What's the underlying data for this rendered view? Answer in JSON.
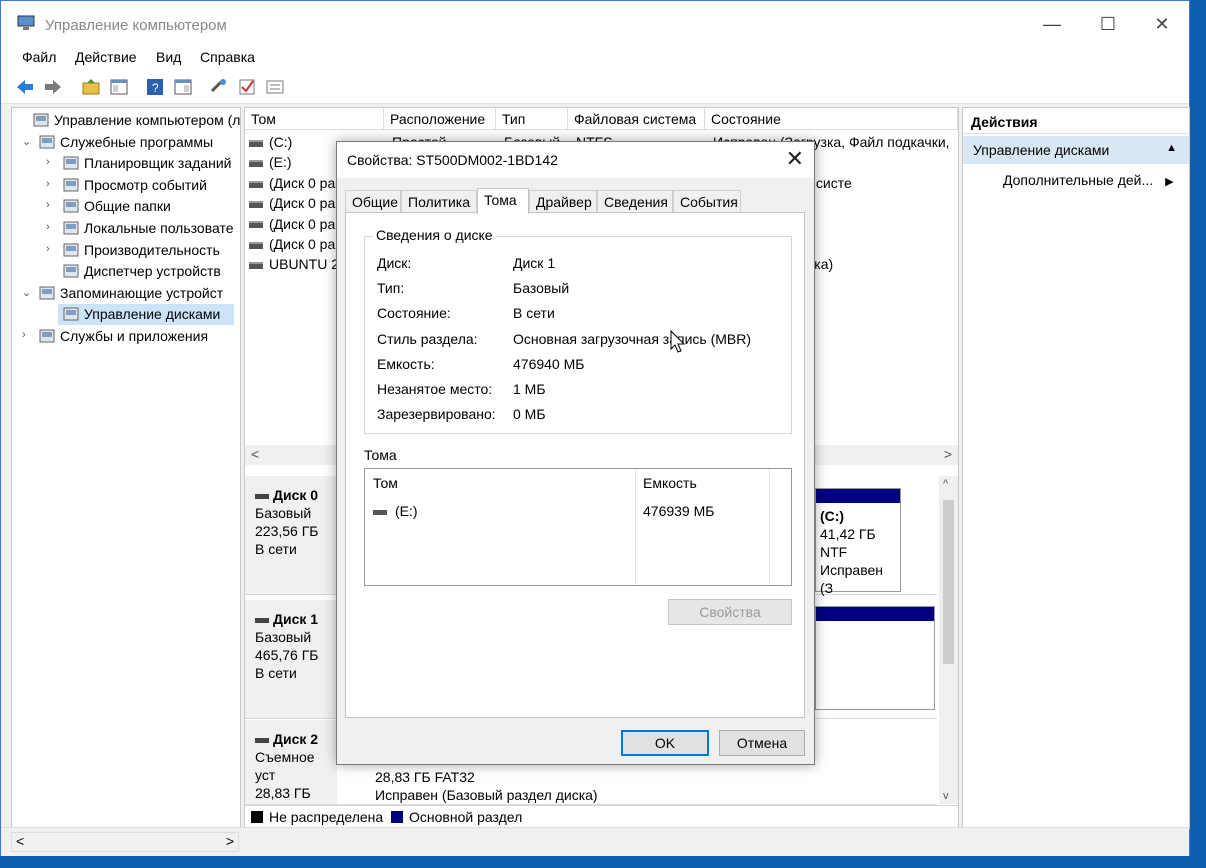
{
  "window": {
    "title": "Управление компьютером",
    "controls": [
      "—",
      "☐",
      "✕"
    ]
  },
  "menu": [
    "Файл",
    "Действие",
    "Вид",
    "Справка"
  ],
  "tree": [
    {
      "label": "Управление компьютером (л",
      "level": 0,
      "arrow": "",
      "icon": "computer-management-icon"
    },
    {
      "label": "Служебные программы",
      "level": 1,
      "arrow": "v",
      "icon": "tools-icon"
    },
    {
      "label": "Планировщик заданий",
      "level": 2,
      "arrow": ">",
      "icon": "clock-icon"
    },
    {
      "label": "Просмотр событий",
      "level": 2,
      "arrow": ">",
      "icon": "event-viewer-icon"
    },
    {
      "label": "Общие папки",
      "level": 2,
      "arrow": ">",
      "icon": "shared-folder-icon"
    },
    {
      "label": "Локальные пользовате",
      "level": 2,
      "arrow": ">",
      "icon": "users-icon"
    },
    {
      "label": "Производительность",
      "level": 2,
      "arrow": ">",
      "icon": "performance-icon"
    },
    {
      "label": "Диспетчер устройств",
      "level": 2,
      "arrow": "",
      "icon": "device-manager-icon"
    },
    {
      "label": "Запоминающие устройст",
      "level": 1,
      "arrow": "v",
      "icon": "storage-icon"
    },
    {
      "label": "Управление дисками",
      "level": 2,
      "arrow": "",
      "icon": "disk-management-icon",
      "selected": true
    },
    {
      "label": "Службы и приложения",
      "level": 1,
      "arrow": ">",
      "icon": "services-icon"
    }
  ],
  "volumes": {
    "headers": [
      "Том",
      "Расположение",
      "Тип",
      "Файловая система",
      "Состояние"
    ],
    "rows": [
      {
        "name": "(C:)",
        "layout": "Простой",
        "type": "Базовый",
        "fs": "NTFS",
        "status": "Исправен (Загрузка, Файл подкачки,"
      },
      {
        "name": "(E:)",
        "status": "овной раздел)"
      },
      {
        "name": "(Диск 0 ра",
        "status": "рованный (EFI) систе"
      },
      {
        "name": "(Диск 0 ра",
        "status": "овной раздел)"
      },
      {
        "name": "(Диск 0 ра",
        "status": "овной раздел)"
      },
      {
        "name": "(Диск 0 ра",
        "status": "овной раздел)"
      },
      {
        "name": "UBUNTU 22",
        "status": "вый раздел диска)"
      }
    ]
  },
  "disks": [
    {
      "name": "Диск 0",
      "type": "Базовый",
      "size": "223,56 ГБ",
      "state": "В сети",
      "part_label": "(C:)",
      "part_size": "41,42 ГБ NTF",
      "part_status": "Исправен (З"
    },
    {
      "name": "Диск 1",
      "type": "Базовый",
      "size": "465,76 ГБ",
      "state": "В сети"
    },
    {
      "name": "Диск 2",
      "type": "Съемное уст",
      "size": "28,83 ГБ",
      "state": "В сети",
      "part_size": "28,83 ГБ FAT32",
      "part_status": "Исправен (Базовый раздел диска)"
    }
  ],
  "legend": [
    {
      "label": "Не распределена",
      "color": "#000000"
    },
    {
      "label": "Основной раздел",
      "color": "#000080"
    }
  ],
  "actions": {
    "header": "Действия",
    "section": "Управление дисками",
    "item": "Дополнительные дей..."
  },
  "dialog": {
    "title": "Свойства: ST500DM002-1BD142",
    "tabs": [
      "Общие",
      "Политика",
      "Тома",
      "Драйвер",
      "Сведения",
      "События"
    ],
    "active_tab": "Тома",
    "group_label": "Сведения о диске",
    "fields": [
      {
        "key": "Диск:",
        "value": "Диск 1"
      },
      {
        "key": "Тип:",
        "value": "Базовый"
      },
      {
        "key": "Состояние:",
        "value": "В сети"
      },
      {
        "key": "Стиль раздела:",
        "value": "Основная загрузочная запись (MBR)"
      },
      {
        "key": "Емкость:",
        "value": "476940 МБ"
      },
      {
        "key": "Незанятое место:",
        "value": "1 МБ"
      },
      {
        "key": "Зарезервировано:",
        "value": "0 МБ"
      }
    ],
    "volumes_label": "Тома",
    "vol_headers": [
      "Том",
      "Емкость"
    ],
    "vol_rows": [
      {
        "name": "(E:)",
        "capacity": "476939 МБ"
      }
    ],
    "properties_button": "Свойства",
    "ok": "OK",
    "cancel": "Отмена"
  },
  "colors": {
    "accent": "#0078d7",
    "selected_bg": "#cce4f7",
    "primary_partition": "#000080"
  }
}
